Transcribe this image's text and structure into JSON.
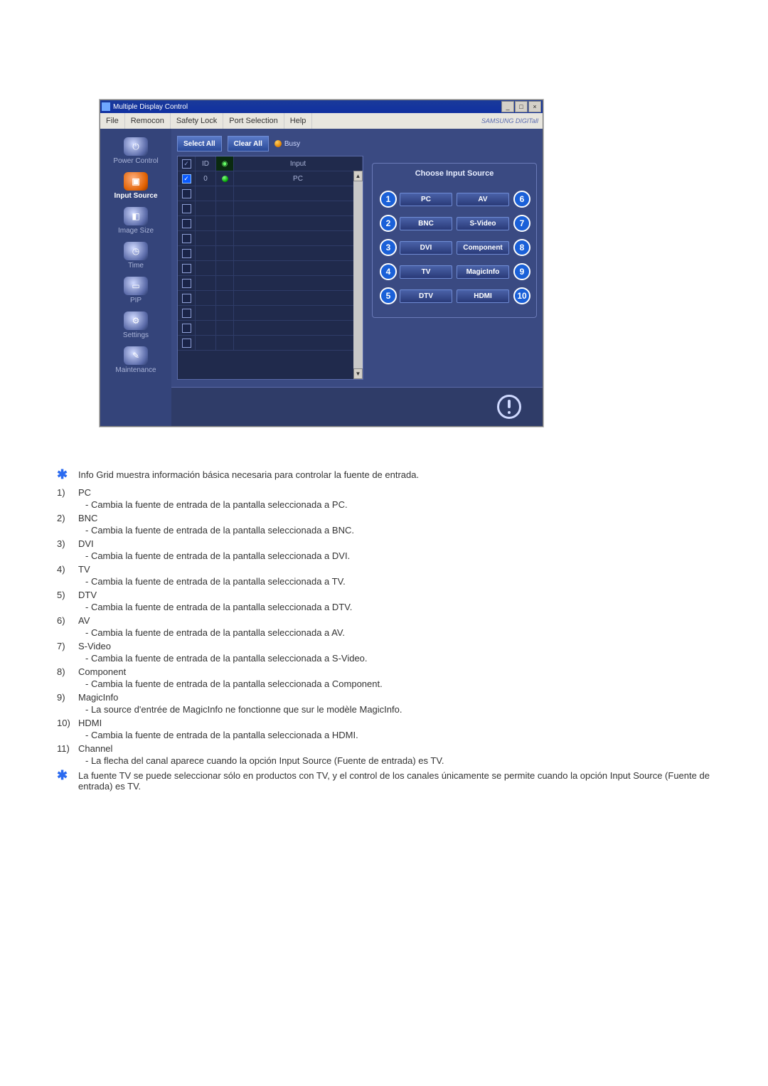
{
  "app": {
    "title": "Multiple Display Control",
    "brand": "SAMSUNG DIGITall",
    "menus": [
      "File",
      "Remocon",
      "Safety Lock",
      "Port Selection",
      "Help"
    ],
    "sidebar": [
      {
        "label": "Power Control",
        "icon": "⏻"
      },
      {
        "label": "Input Source",
        "icon": "▣",
        "active": true
      },
      {
        "label": "Image Size",
        "icon": "◧"
      },
      {
        "label": "Time",
        "icon": "◷"
      },
      {
        "label": "PIP",
        "icon": "▭"
      },
      {
        "label": "Settings",
        "icon": "⚙"
      },
      {
        "label": "Maintenance",
        "icon": "✎"
      }
    ],
    "actions": {
      "select_all": "Select All",
      "clear_all": "Clear All",
      "busy": "Busy"
    },
    "grid": {
      "headers": {
        "id": "ID",
        "input": "Input"
      },
      "rows": [
        {
          "checked": true,
          "id": "0",
          "status": "green",
          "input": "PC"
        },
        {
          "checked": false
        },
        {
          "checked": false
        },
        {
          "checked": false
        },
        {
          "checked": false
        },
        {
          "checked": false
        },
        {
          "checked": false
        },
        {
          "checked": false
        },
        {
          "checked": false
        },
        {
          "checked": false
        },
        {
          "checked": false
        },
        {
          "checked": false
        }
      ]
    },
    "panel": {
      "title": "Choose Input Source",
      "left": [
        {
          "n": "1",
          "l": "PC"
        },
        {
          "n": "2",
          "l": "BNC"
        },
        {
          "n": "3",
          "l": "DVI"
        },
        {
          "n": "4",
          "l": "TV"
        },
        {
          "n": "5",
          "l": "DTV"
        }
      ],
      "right": [
        {
          "n": "6",
          "l": "AV"
        },
        {
          "n": "7",
          "l": "S-Video"
        },
        {
          "n": "8",
          "l": "Component"
        },
        {
          "n": "9",
          "l": "MagicInfo"
        },
        {
          "n": "10",
          "l": "HDMI"
        }
      ]
    }
  },
  "notes": {
    "intro": "Info Grid muestra información básica necesaria para controlar la fuente de entrada.",
    "final": "La fuente TV se puede seleccionar sólo en productos con TV, y el control de los canales únicamente se permite cuando la opción Input Source (Fuente de entrada) es TV."
  },
  "items": [
    {
      "n": "1)",
      "label": "PC",
      "detail": "- Cambia la fuente de entrada de la pantalla seleccionada a PC."
    },
    {
      "n": "2)",
      "label": "BNC",
      "detail": "- Cambia la fuente de entrada de la pantalla seleccionada a BNC."
    },
    {
      "n": "3)",
      "label": "DVI",
      "detail": "- Cambia la fuente de entrada de la pantalla seleccionada a DVI."
    },
    {
      "n": "4)",
      "label": "TV",
      "detail": "- Cambia la fuente de entrada de la pantalla seleccionada a TV."
    },
    {
      "n": "5)",
      "label": "DTV",
      "detail": "- Cambia la fuente de entrada de la pantalla seleccionada a DTV."
    },
    {
      "n": "6)",
      "label": "AV",
      "detail": "- Cambia la fuente de entrada de la pantalla seleccionada a AV."
    },
    {
      "n": "7)",
      "label": "S-Video",
      "detail": "- Cambia la fuente de entrada de la pantalla seleccionada a S-Video."
    },
    {
      "n": "8)",
      "label": "Component",
      "detail": "- Cambia la fuente de entrada de la pantalla seleccionada a Component."
    },
    {
      "n": "9)",
      "label": "MagicInfo",
      "detail": "- La source d'entrée de MagicInfo ne fonctionne que sur le modèle MagicInfo."
    },
    {
      "n": "10)",
      "label": "HDMI",
      "detail": "- Cambia la fuente de entrada de la pantalla seleccionada a HDMI."
    },
    {
      "n": "11)",
      "label": "Channel",
      "detail": "- La flecha del canal aparece cuando la opción Input Source (Fuente de entrada) es TV."
    }
  ]
}
